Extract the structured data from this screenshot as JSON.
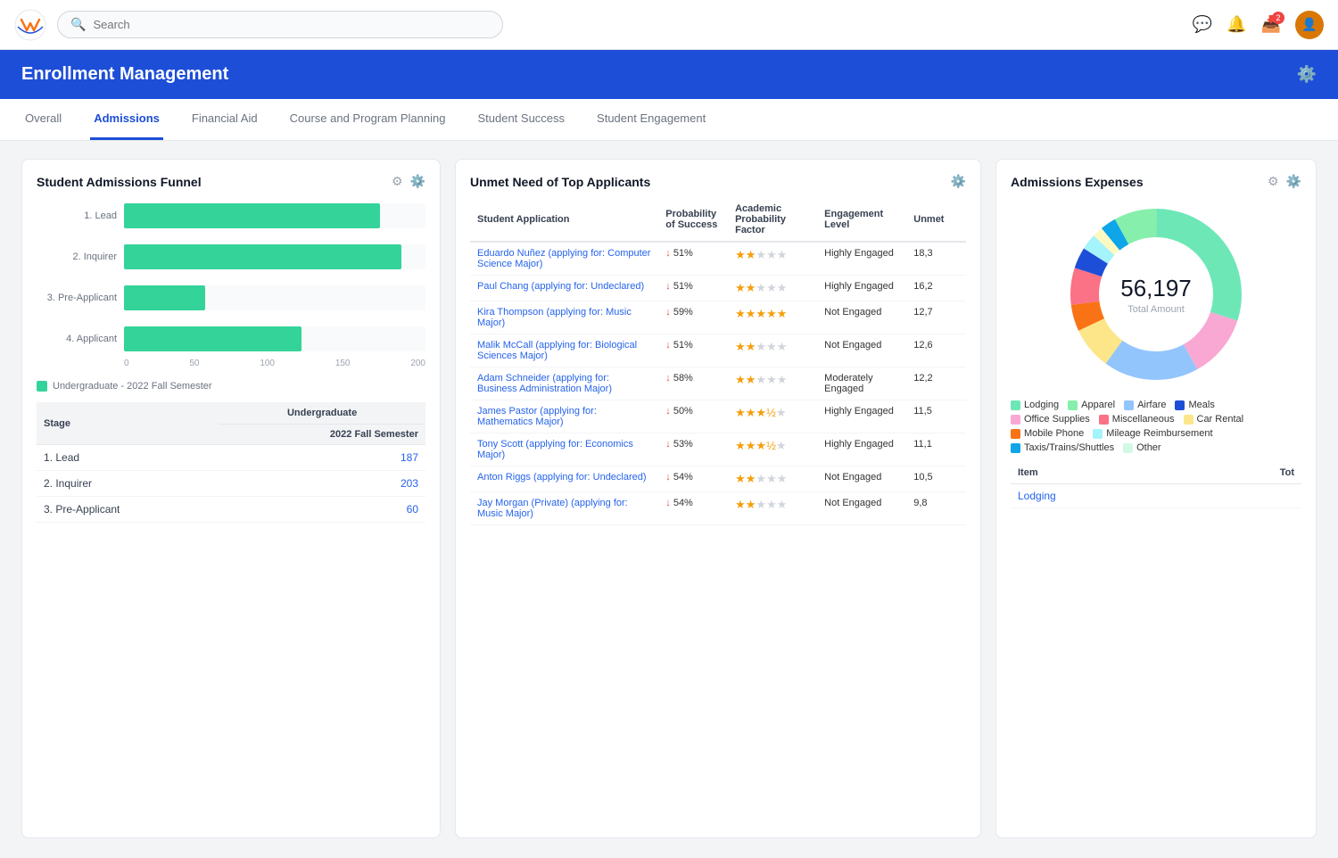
{
  "app": {
    "logo": "W",
    "search_placeholder": "Search"
  },
  "header": {
    "title": "Enrollment Management",
    "gear_icon": "⚙"
  },
  "tabs": [
    {
      "label": "Overall",
      "active": false
    },
    {
      "label": "Admissions",
      "active": true
    },
    {
      "label": "Financial Aid",
      "active": false
    },
    {
      "label": "Course and Program Planning",
      "active": false
    },
    {
      "label": "Student Success",
      "active": false
    },
    {
      "label": "Student Engagement",
      "active": false
    }
  ],
  "funnel_panel": {
    "title": "Student Admissions Funnel",
    "legend_label": "Undergraduate - 2022 Fall Semester",
    "bars": [
      {
        "label": "1. Lead",
        "value": 187,
        "max": 220,
        "width_pct": 85
      },
      {
        "label": "2. Inquirer",
        "value": 203,
        "max": 220,
        "width_pct": 92
      },
      {
        "label": "3. Pre-Applicant",
        "value": 60,
        "max": 220,
        "width_pct": 27
      },
      {
        "label": "4. Applicant",
        "value": 130,
        "max": 220,
        "width_pct": 59
      }
    ],
    "x_labels": [
      "0",
      "50",
      "100",
      "150",
      "200"
    ],
    "table_header_col1": "Stage",
    "table_undergraduate_label": "Undergraduate",
    "table_semester_label": "2022 Fall Semester",
    "table_rows": [
      {
        "stage": "1. Lead",
        "value": "187"
      },
      {
        "stage": "2. Inquirer",
        "value": "203"
      },
      {
        "stage": "3. Pre-Applicant",
        "value": "60"
      }
    ]
  },
  "unmet_panel": {
    "title": "Unmet Need of Top Applicants",
    "columns": [
      "Student Application",
      "Probability of Success",
      "Academic Probability Factor",
      "Engagement Level",
      "Unmet"
    ],
    "rows": [
      {
        "name": "Eduardo Nuñez (applying for: Computer Science Major)",
        "prob": "51%",
        "stars": 2,
        "engagement": "Highly Engaged",
        "unmet": "18,3"
      },
      {
        "name": "Paul Chang (applying for: Undeclared)",
        "prob": "51%",
        "stars": 2,
        "engagement": "Highly Engaged",
        "unmet": "16,2"
      },
      {
        "name": "Kira Thompson (applying for: Music Major)",
        "prob": "59%",
        "stars": 5,
        "engagement": "Not Engaged",
        "unmet": "12,7"
      },
      {
        "name": "Malik McCall (applying for: Biological Sciences Major)",
        "prob": "51%",
        "stars": 2,
        "engagement": "Not Engaged",
        "unmet": "12,6"
      },
      {
        "name": "Adam Schneider (applying for: Business Administration Major)",
        "prob": "58%",
        "stars": 2,
        "engagement": "Moderately Engaged",
        "unmet": "12,2"
      },
      {
        "name": "James Pastor (applying for: Mathematics Major)",
        "prob": "50%",
        "stars": 3.5,
        "engagement": "Highly Engaged",
        "unmet": "11,5"
      },
      {
        "name": "Tony Scott (applying for: Economics Major)",
        "prob": "53%",
        "stars": 3.5,
        "engagement": "Highly Engaged",
        "unmet": "11,1"
      },
      {
        "name": "Anton Riggs (applying for: Undeclared)",
        "prob": "54%",
        "stars": 2,
        "engagement": "Not Engaged",
        "unmet": "10,5"
      },
      {
        "name": "Jay Morgan (Private) (applying for: Music Major)",
        "prob": "54%",
        "stars": 2,
        "engagement": "Not Engaged",
        "unmet": "9,8"
      }
    ]
  },
  "expenses_panel": {
    "title": "Admissions Expenses",
    "total_amount": "56,197",
    "total_label": "Total Amount",
    "legend": [
      {
        "label": "Lodging",
        "color": "#6ee7b7"
      },
      {
        "label": "Apparel",
        "color": "#86efac"
      },
      {
        "label": "Airfare",
        "color": "#93c5fd"
      },
      {
        "label": "Meals",
        "color": "#1d4ed8"
      },
      {
        "label": "Office Supplies",
        "color": "#f9a8d4"
      },
      {
        "label": "Miscellaneous",
        "color": "#fb7185"
      },
      {
        "label": "Car Rental",
        "color": "#fde68a"
      },
      {
        "label": "Mobile Phone",
        "color": "#f97316"
      },
      {
        "label": "Mileage Reimbursement",
        "color": "#a5f3fc"
      },
      {
        "label": "Taxis/Trains/Shuttles",
        "color": "#0ea5e9"
      },
      {
        "label": "Other",
        "color": "#fef9c3"
      }
    ],
    "donut_segments": [
      {
        "label": "Lodging",
        "color": "#6ee7b7",
        "pct": 30
      },
      {
        "label": "Office Supplies",
        "color": "#f9a8d4",
        "pct": 12
      },
      {
        "label": "Airfare",
        "color": "#93c5fd",
        "pct": 18
      },
      {
        "label": "Car Rental",
        "color": "#fde68a",
        "pct": 8
      },
      {
        "label": "Mobile Phone",
        "color": "#f97316",
        "pct": 5
      },
      {
        "label": "Miscellaneous",
        "color": "#fb7185",
        "pct": 7
      },
      {
        "label": "Meals",
        "color": "#1d4ed8",
        "pct": 4
      },
      {
        "label": "Mileage Reimbursement",
        "color": "#a5f3fc",
        "pct": 3
      },
      {
        "label": "Other",
        "color": "#fef9c3",
        "pct": 2
      },
      {
        "label": "Taxis/Trains/Shuttles",
        "color": "#0ea5e9",
        "pct": 3
      },
      {
        "label": "Apparel",
        "color": "#86efac",
        "pct": 8
      }
    ],
    "table_col_item": "Item",
    "table_col_total": "Tot",
    "table_rows": [
      {
        "item": "Lodging",
        "total": ""
      }
    ]
  }
}
